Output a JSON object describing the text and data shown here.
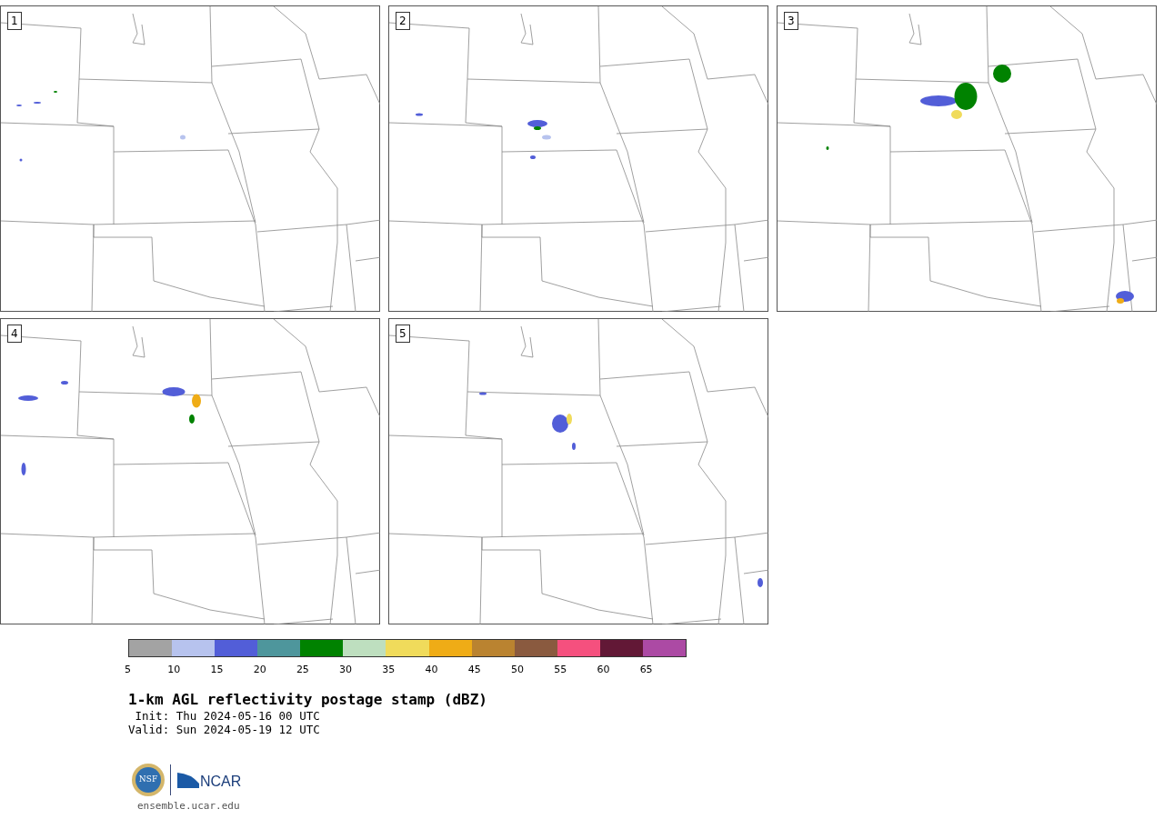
{
  "panels": [
    {
      "label": "1"
    },
    {
      "label": "2"
    },
    {
      "label": "3"
    },
    {
      "label": "4"
    },
    {
      "label": "5"
    }
  ],
  "colorbar": {
    "bins": [
      {
        "color": "#a3a3a3"
      },
      {
        "color": "#b7c3ee"
      },
      {
        "color": "#525ed8"
      },
      {
        "color": "#4e969c"
      },
      {
        "color": "#008200"
      },
      {
        "color": "#bedfbf"
      },
      {
        "color": "#f0db5b"
      },
      {
        "color": "#efac16"
      },
      {
        "color": "#ba8330"
      },
      {
        "color": "#8a5a3f"
      },
      {
        "color": "#f5507e"
      },
      {
        "color": "#621836"
      },
      {
        "color": "#ac4aa4"
      }
    ],
    "ticks": [
      "5",
      "10",
      "15",
      "20",
      "25",
      "30",
      "35",
      "40",
      "45",
      "50",
      "55",
      "60",
      "65"
    ]
  },
  "title": "1-km AGL reflectivity postage stamp (dBZ)",
  "init": " Init: Thu 2024-05-16 00 UTC",
  "valid": "Valid: Sun 2024-05-19 12 UTC",
  "logos": {
    "nsf": "NSF",
    "ncar": "NCAR"
  },
  "footer": "ensemble.ucar.edu"
}
